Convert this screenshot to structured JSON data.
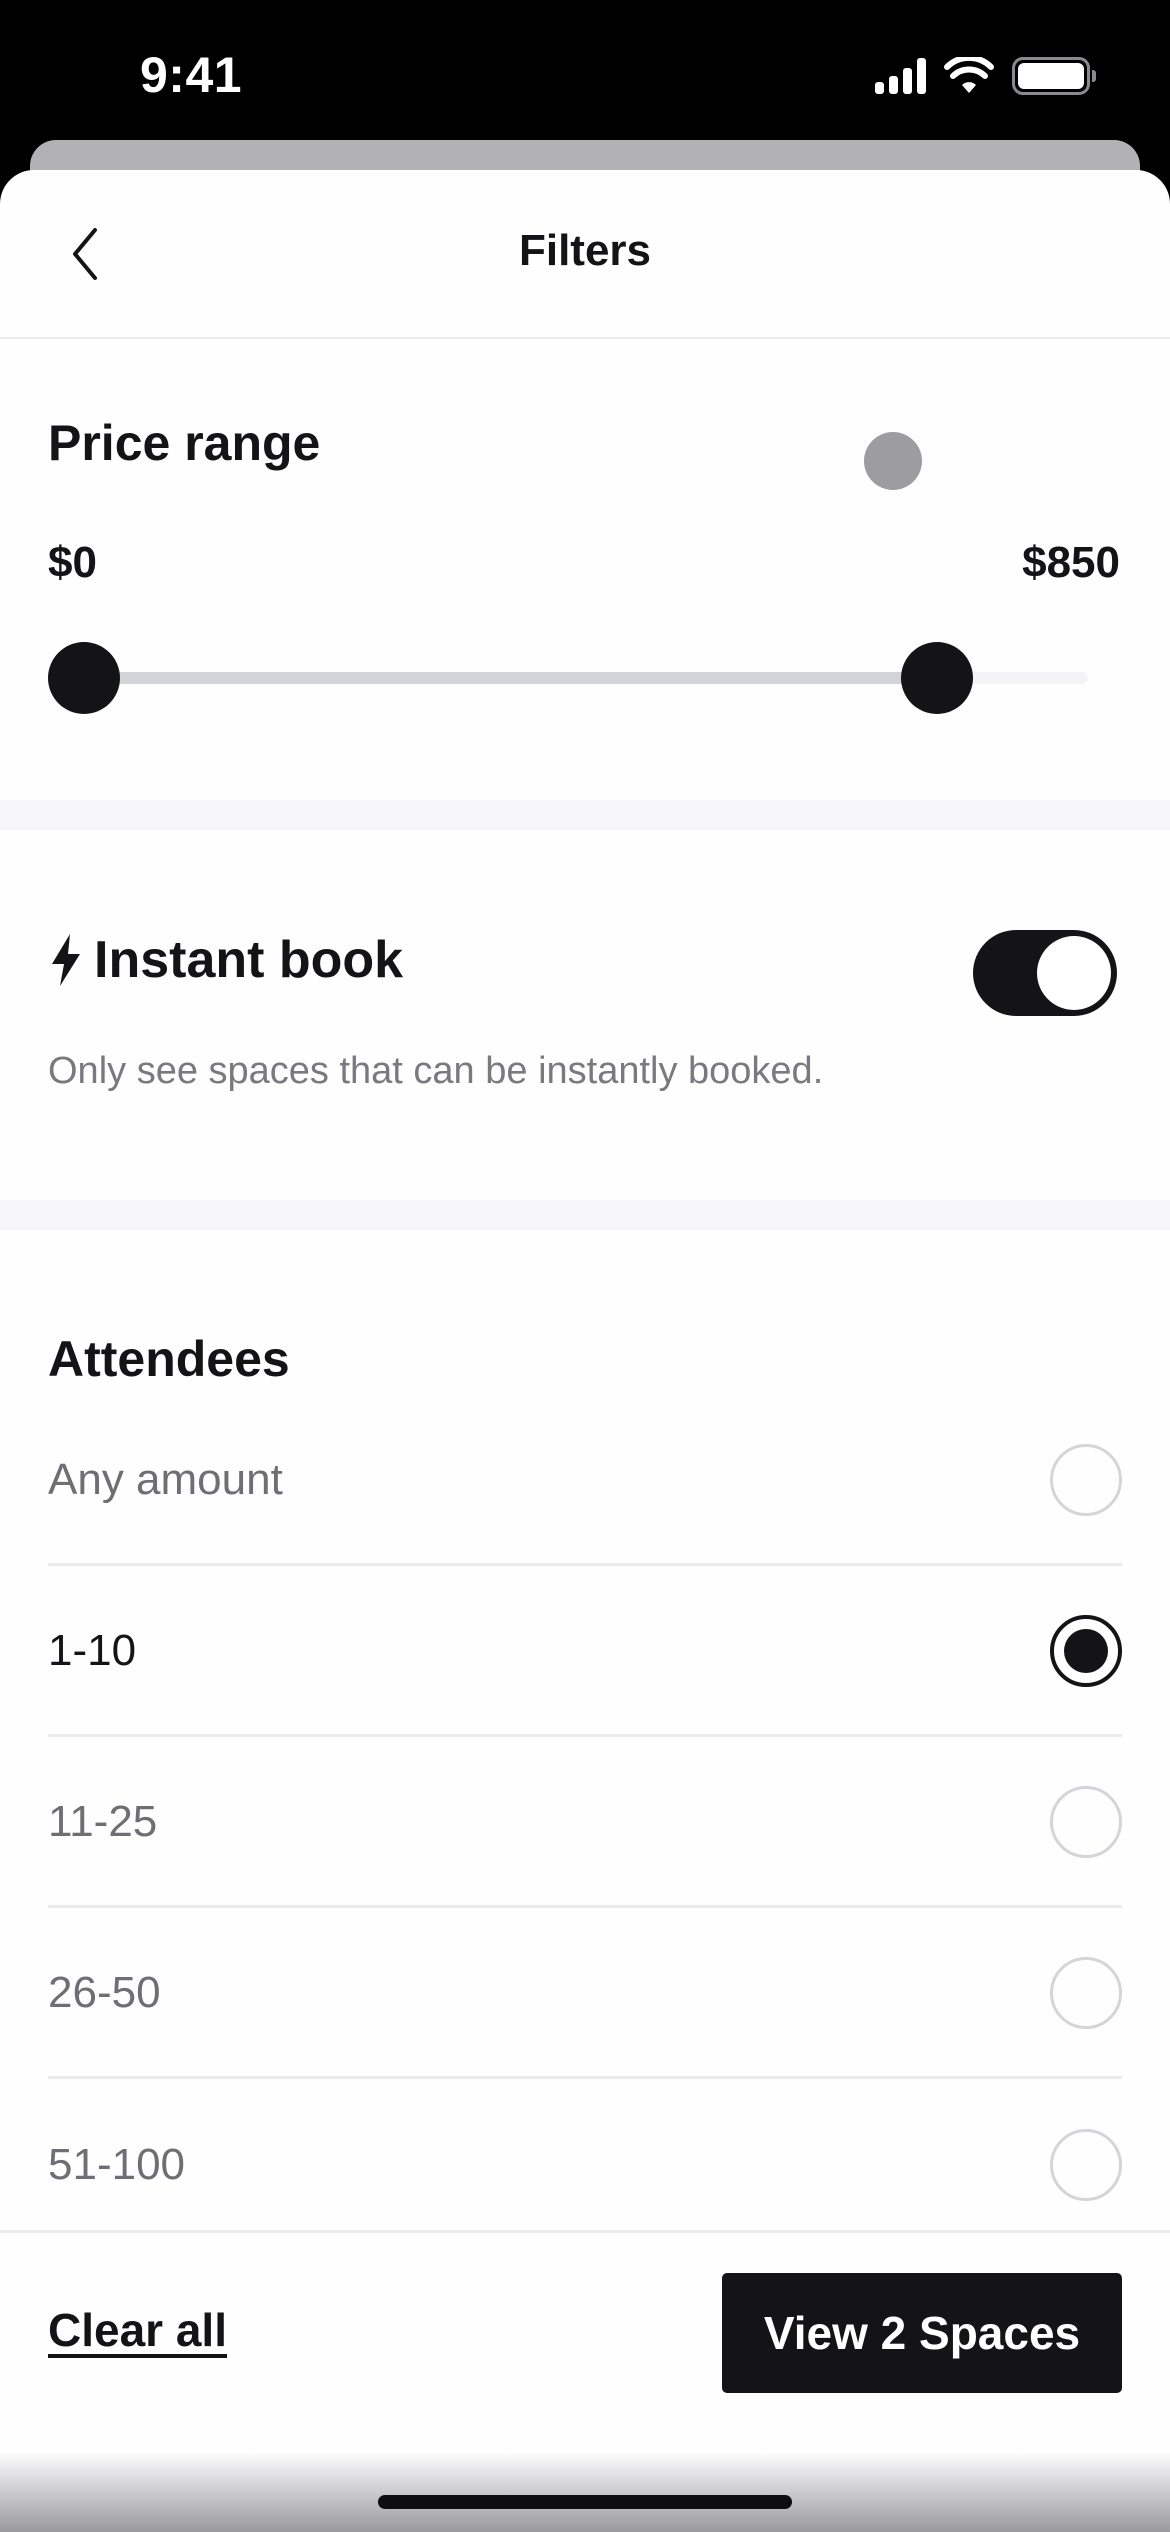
{
  "status_bar": {
    "time": "9:41",
    "icons": [
      "cellular-signal-icon",
      "wifi-icon",
      "battery-icon"
    ]
  },
  "header": {
    "title": "Filters",
    "back_icon": "chevron-left-icon"
  },
  "price_range": {
    "title": "Price range",
    "min_label": "$0",
    "max_label": "$850",
    "selected_min_fraction": 0.0,
    "selected_max_fraction": 0.85
  },
  "instant_book": {
    "icon": "lightning-bolt-icon",
    "title": "Instant book",
    "description": "Only see spaces that can be instantly booked.",
    "enabled": true
  },
  "attendees": {
    "title": "Attendees",
    "options": [
      {
        "label": "Any amount",
        "selected": false
      },
      {
        "label": "1-10",
        "selected": true
      },
      {
        "label": "11-25",
        "selected": false
      },
      {
        "label": "26-50",
        "selected": false
      },
      {
        "label": "51-100",
        "selected": false
      }
    ]
  },
  "footer": {
    "clear_label": "Clear all",
    "view_label": "View 2 Spaces"
  },
  "colors": {
    "primary": "#141316",
    "muted_text": "#7a7980",
    "track": "#d3d3da",
    "background": "#fefeff"
  }
}
